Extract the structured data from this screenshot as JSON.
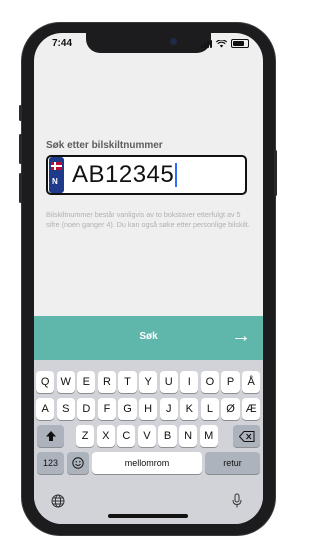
{
  "status_bar": {
    "time": "7:44"
  },
  "search": {
    "label": "Søk etter bilskiltnummer",
    "plate_value": "AB12345",
    "flag_letter": "N",
    "help_text": "Bilskiltnummer består vanligvis av to bokstaver etterfulgt av 5 sifre (noen ganger 4). Du kan også søke etter personlige bilskilt."
  },
  "action": {
    "label": "Søk",
    "arrow_icon": "arrow-right-icon"
  },
  "keyboard": {
    "row1": [
      "Q",
      "W",
      "E",
      "R",
      "T",
      "Y",
      "U",
      "I",
      "O",
      "P",
      "Å"
    ],
    "row2": [
      "A",
      "S",
      "D",
      "F",
      "G",
      "H",
      "J",
      "K",
      "L",
      "Ø",
      "Æ"
    ],
    "row3": [
      "Z",
      "X",
      "C",
      "V",
      "B",
      "N",
      "M"
    ],
    "numbers_key": "123",
    "space_key": "mellomrom",
    "return_key": "retur",
    "shift_icon": "shift-icon",
    "backspace_icon": "backspace-icon",
    "emoji_icon": "emoji-icon",
    "globe_icon": "globe-icon",
    "mic_icon": "microphone-icon"
  },
  "colors": {
    "accent": "#5fb7ac",
    "cursor": "#2f6bff"
  }
}
